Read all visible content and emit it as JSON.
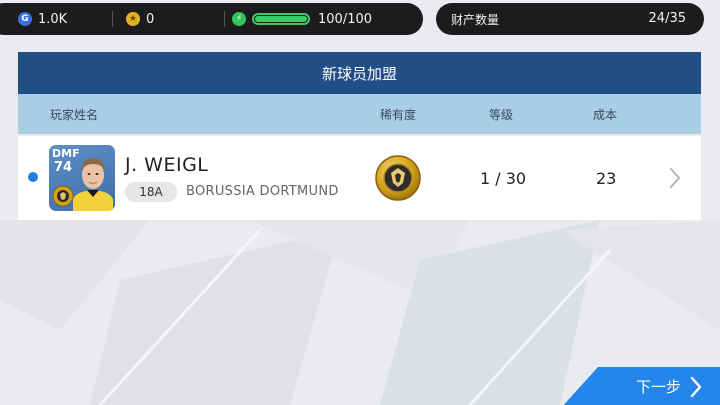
{
  "status": {
    "gp": "1.0K",
    "coins": "0",
    "energy": "100/100",
    "energy_fraction": 1.0
  },
  "assets": {
    "label": "财产数量",
    "value": "24/35"
  },
  "panel": {
    "title": "新球员加盟",
    "columns": {
      "name": "玩家姓名",
      "rarity": "稀有度",
      "level": "等级",
      "cost": "成本"
    }
  },
  "player": {
    "position": "DMF",
    "rating": "74",
    "name": "J. WEIGL",
    "age": "18A",
    "club": "BORUSSIA DORTMUND",
    "level": "1 / 30",
    "cost": "23"
  },
  "next_button": {
    "label": "下一步"
  },
  "colors": {
    "header": "#224e86",
    "subheader": "#a9cde4",
    "accent": "#2286ea",
    "gold": "#d4a21c",
    "energy": "#3fc864"
  }
}
